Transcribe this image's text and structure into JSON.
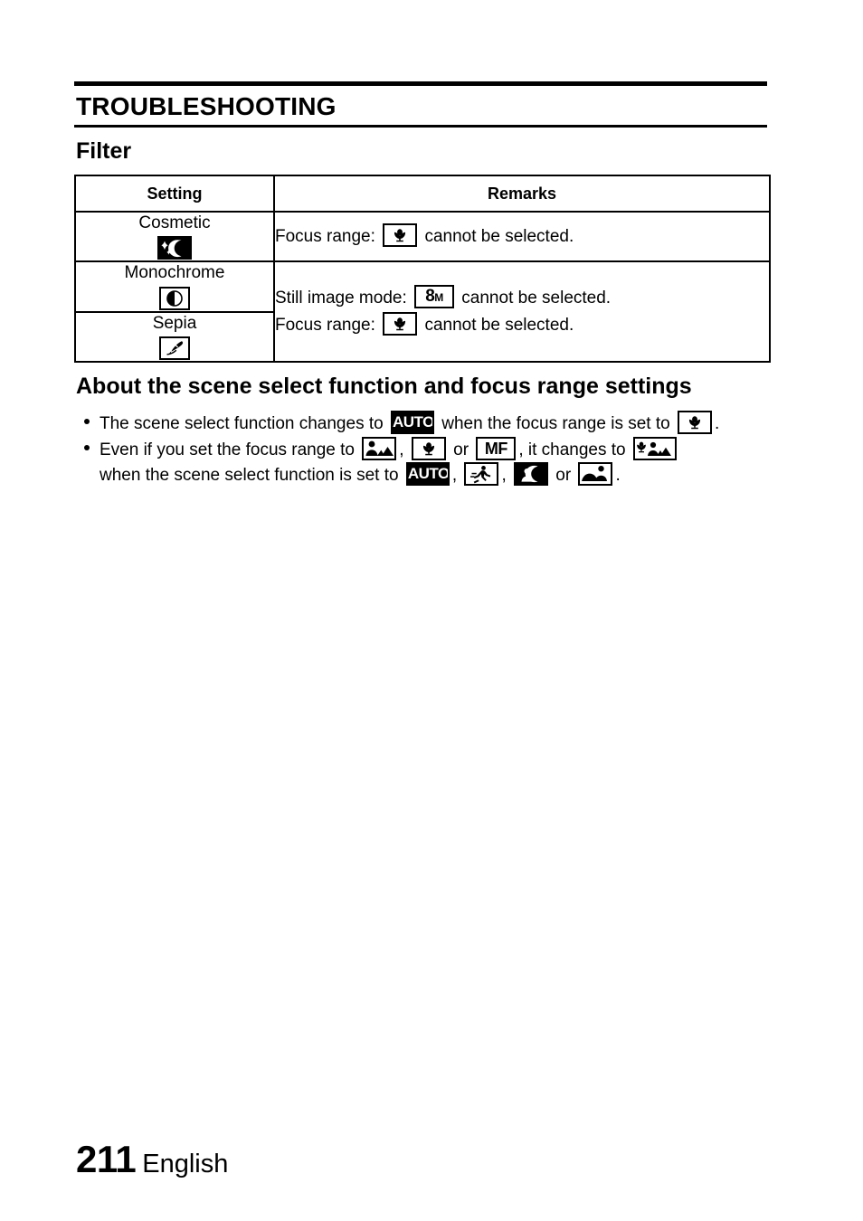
{
  "document": {
    "chapter_title": "TROUBLESHOOTING",
    "section_title": "Filter",
    "subsection_title": "About the scene select function and focus range settings"
  },
  "table": {
    "headers": {
      "setting": "Setting",
      "remarks": "Remarks"
    },
    "rows": [
      {
        "setting_label": "Cosmetic",
        "setting_icon": "cosmetic-filter-icon",
        "remarks_lines": [
          {
            "prefix": "Focus range:",
            "icon": "macro-focus-icon",
            "suffix": "cannot be selected."
          }
        ]
      },
      {
        "setting_label": "Monochrome",
        "setting_icon": "monochrome-filter-icon",
        "remarks_lines": [
          {
            "prefix": "Still image mode:",
            "icon": "8m-resolution-icon",
            "suffix": "cannot be selected."
          },
          {
            "prefix": "Focus range:",
            "icon": "macro-focus-icon",
            "suffix": "cannot be selected."
          }
        ]
      },
      {
        "setting_label": "Sepia",
        "setting_icon": "sepia-filter-icon",
        "remarks_lines": []
      }
    ]
  },
  "notes": [
    {
      "segments": [
        {
          "type": "text",
          "value": "The scene select function changes to"
        },
        {
          "type": "icon",
          "value": "auto-scene-icon"
        },
        {
          "type": "text",
          "value": "when the focus range is set to"
        },
        {
          "type": "icon",
          "value": "macro-focus-icon"
        },
        {
          "type": "text",
          "value": "."
        }
      ],
      "line1_text_a": "The scene select function changes to",
      "line1_text_b": "when the focus range is set to",
      "line1_text_c": "."
    },
    {
      "line1_text_a": "Even if you set the focus range to",
      "line1_text_b": ",",
      "line1_text_c": "or",
      "line1_text_d": ", it changes to",
      "line2_text_a": "when the scene select function is set to",
      "line2_text_b": ",",
      "line2_text_c": ",",
      "line2_text_d": "or",
      "line2_text_e": "."
    }
  ],
  "icons": {
    "auto_label": "AUTO",
    "mf_label": "MF",
    "eightm_digit": "8",
    "eightm_unit": "M"
  },
  "footer": {
    "page_number": "211",
    "language": "English"
  },
  "colors": {
    "text": "#000000",
    "background": "#ffffff",
    "rule": "#000000"
  }
}
